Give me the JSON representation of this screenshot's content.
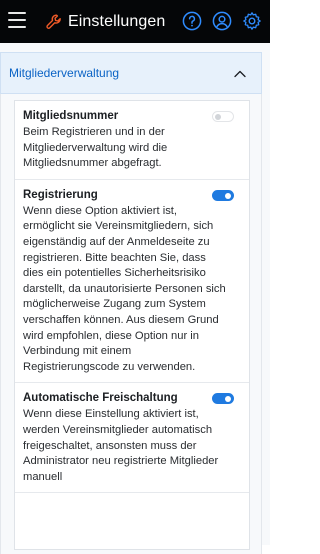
{
  "header": {
    "title": "Einstellungen",
    "title_icon": "wrench-icon",
    "icons": [
      "menu-icon",
      "help-icon",
      "user-icon",
      "gear-icon"
    ],
    "accent_color": "#2f8cff",
    "wrench_color": "#f05a28"
  },
  "section": {
    "title": "Mitgliederverwaltung",
    "expanded": true
  },
  "settings": [
    {
      "name": "Mitgliedsnummer",
      "description": "Beim Registrieren und in der Mitgliederverwaltung wird die Mitgliedsnummer abgefragt.",
      "enabled": false
    },
    {
      "name": "Registrierung",
      "description": "Wenn diese Option aktiviert ist, ermöglicht sie Vereinsmitgliedern, sich eigenständig auf der Anmeldeseite zu registrieren. Bitte beachten Sie, dass dies ein potentielles Sicherheitsrisiko darstellt, da unautorisierte Personen sich möglicherweise Zugang zum System verschaffen können. Aus diesem Grund wird empfohlen, diese Option nur in Verbindung mit einem Registrierungscode zu verwenden.",
      "enabled": true
    },
    {
      "name": "Automatische Freischaltung",
      "description": "Wenn diese Einstellung aktiviert ist, werden Vereinsmitglieder automatisch freigeschaltet, ansonsten muss der Administrator neu registrierte Mitglieder manuell",
      "enabled": true
    }
  ]
}
